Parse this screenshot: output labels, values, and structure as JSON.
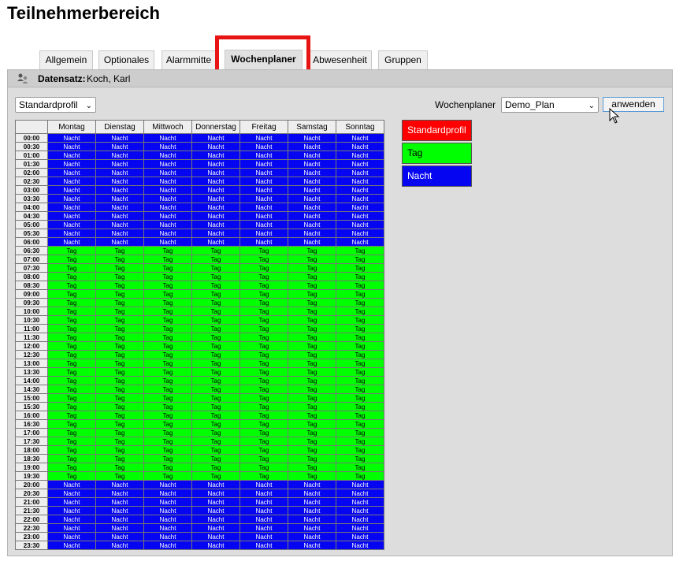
{
  "page_title": "Teilnehmerbereich",
  "tabs": [
    {
      "label": "Allgemein",
      "active": false
    },
    {
      "label": "Optionales",
      "active": false
    },
    {
      "label": "Alarmmitte",
      "active": false
    },
    {
      "label": "Wochenplaner",
      "active": true
    },
    {
      "label": "Abwesenheit",
      "active": false
    },
    {
      "label": "Gruppen",
      "active": false
    }
  ],
  "dataset": {
    "label": "Datensatz:",
    "value": "Koch, Karl"
  },
  "profile_select": {
    "value": "Standardprofil"
  },
  "planner": {
    "label": "Wochenplaner",
    "value": "Demo_Plan",
    "apply_label": "anwenden"
  },
  "schedule": {
    "days": [
      "Montag",
      "Dienstag",
      "Mittwoch",
      "Donnerstag",
      "Freitag",
      "Samstag",
      "Sonntag"
    ],
    "times": [
      "00:00",
      "00:30",
      "01:00",
      "01:30",
      "02:00",
      "02:30",
      "03:00",
      "03:30",
      "04:00",
      "04:30",
      "05:00",
      "05:30",
      "06:00",
      "06:30",
      "07:00",
      "07:30",
      "08:00",
      "08:30",
      "09:00",
      "09:30",
      "10:00",
      "10:30",
      "11:00",
      "11:30",
      "12:00",
      "12:30",
      "13:00",
      "13:30",
      "14:00",
      "14:30",
      "15:00",
      "15:30",
      "16:00",
      "16:30",
      "17:00",
      "17:30",
      "18:00",
      "18:30",
      "19:00",
      "19:30",
      "20:00",
      "20:30",
      "21:00",
      "21:30",
      "22:00",
      "22:30",
      "23:00",
      "23:30"
    ],
    "slot_profiles": [
      "Nacht",
      "Nacht",
      "Nacht",
      "Nacht",
      "Nacht",
      "Nacht",
      "Nacht",
      "Nacht",
      "Nacht",
      "Nacht",
      "Nacht",
      "Nacht",
      "Nacht",
      "Tag",
      "Tag",
      "Tag",
      "Tag",
      "Tag",
      "Tag",
      "Tag",
      "Tag",
      "Tag",
      "Tag",
      "Tag",
      "Tag",
      "Tag",
      "Tag",
      "Tag",
      "Tag",
      "Tag",
      "Tag",
      "Tag",
      "Tag",
      "Tag",
      "Tag",
      "Tag",
      "Tag",
      "Tag",
      "Tag",
      "Tag",
      "Nacht",
      "Nacht",
      "Nacht",
      "Nacht",
      "Nacht",
      "Nacht",
      "Nacht",
      "Nacht"
    ]
  },
  "legend": [
    {
      "label": "Standardprofil",
      "color": "#ff0000"
    },
    {
      "label": "Tag",
      "color": "#00ff00"
    },
    {
      "label": "Nacht",
      "color": "#0505f2"
    }
  ],
  "icons": {
    "dataset": "user-group-icon",
    "dropdown": "chevron-down-icon",
    "cursor": "mouse-pointer-icon"
  }
}
